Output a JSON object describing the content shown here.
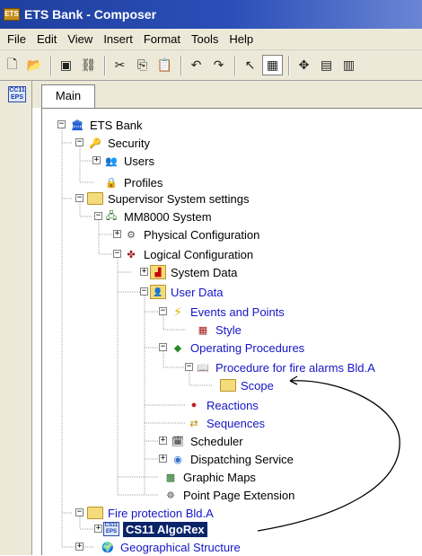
{
  "window": {
    "title": "ETS Bank - Composer",
    "icon": "app-icon"
  },
  "menu": [
    "File",
    "Edit",
    "View",
    "Insert",
    "Format",
    "Tools",
    "Help"
  ],
  "toolbar": {
    "buttons": [
      "new-icon",
      "open-icon",
      "properties-icon",
      "link-icon",
      "cut-icon",
      "copy-icon",
      "paste-icon",
      "undo-icon",
      "redo-icon",
      "pointer-icon",
      "grid-icon",
      "move-icon",
      "layout-icon",
      "layout-alt-icon"
    ]
  },
  "rail": {
    "icon": "cs11-eps-icon",
    "line1": "CC11",
    "line2": "EPS"
  },
  "tabs": [
    {
      "label": "Main",
      "active": true
    }
  ],
  "tree": {
    "nodes": [
      {
        "label": "ETS Bank",
        "icon": "bank-icon"
      },
      {
        "label": "Security",
        "icon": "key-icon"
      },
      {
        "label": "Users",
        "icon": "users-icon"
      },
      {
        "label": "Profiles",
        "icon": "lock-icon"
      },
      {
        "label": "Supervisor System settings",
        "icon": "folder-icon"
      },
      {
        "label": "MM8000 System",
        "icon": "network-icon"
      },
      {
        "label": "Physical Configuration",
        "icon": "gears-icon"
      },
      {
        "label": "Logical Configuration",
        "icon": "logic-icon"
      },
      {
        "label": "System Data",
        "icon": "chart-icon"
      },
      {
        "label": "User Data",
        "icon": "user-data-icon"
      },
      {
        "label": "Events and Points",
        "icon": "lightning-icon"
      },
      {
        "label": "Style",
        "icon": "table-icon"
      },
      {
        "label": "Operating Procedures",
        "icon": "procedure-icon"
      },
      {
        "label": "Procedure for fire alarms Bld.A",
        "icon": "book-icon"
      },
      {
        "label": "Scope",
        "icon": "folder-icon"
      },
      {
        "label": "Reactions",
        "icon": "reactions-icon"
      },
      {
        "label": "Sequences",
        "icon": "sequences-icon"
      },
      {
        "label": "Scheduler",
        "icon": "scheduler-icon"
      },
      {
        "label": "Dispatching Service",
        "icon": "dispatch-icon"
      },
      {
        "label": "Graphic Maps",
        "icon": "map-icon"
      },
      {
        "label": "Point Page Extension",
        "icon": "point-page-icon"
      },
      {
        "label": "Fire protection Bld.A",
        "icon": "folder-icon"
      },
      {
        "label": "CS11 AlgoRex",
        "icon": "cs11-eps-icon",
        "selected": true,
        "badge1": "CS11",
        "badge2": "EPS"
      },
      {
        "label": "Geographical Structure",
        "icon": "globe-icon"
      }
    ]
  }
}
